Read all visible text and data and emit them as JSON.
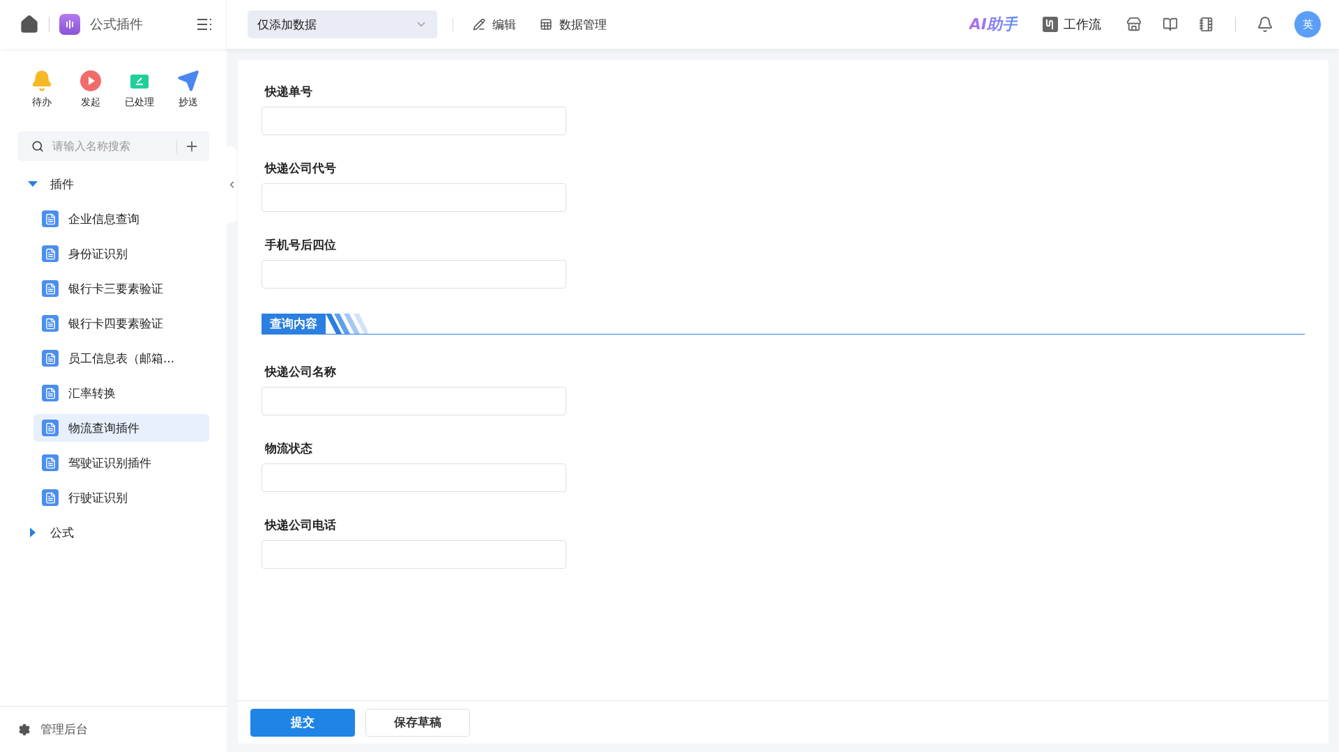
{
  "header": {
    "app_title": "公式插件",
    "mode_select": {
      "value": "仅添加数据"
    },
    "actions": [
      {
        "kind": "edit",
        "label": "编辑"
      },
      {
        "kind": "data",
        "label": "数据管理"
      }
    ],
    "ai_label": "AI助手",
    "workflow_label": "工作流",
    "avatar_text": "英"
  },
  "sidebar": {
    "quick_actions": [
      {
        "kind": "todo",
        "label": "待办"
      },
      {
        "kind": "start",
        "label": "发起"
      },
      {
        "kind": "done",
        "label": "已处理"
      },
      {
        "kind": "cc",
        "label": "抄送"
      }
    ],
    "search": {
      "placeholder": "请输入名称搜索"
    },
    "tree": [
      {
        "label": "插件",
        "expanded": true,
        "children": [
          {
            "label": "企业信息查询",
            "selected": false
          },
          {
            "label": "身份证识别",
            "selected": false
          },
          {
            "label": "银行卡三要素验证",
            "selected": false
          },
          {
            "label": "银行卡四要素验证",
            "selected": false
          },
          {
            "label": "员工信息表（邮箱...",
            "selected": false
          },
          {
            "label": "汇率转换",
            "selected": false
          },
          {
            "label": "物流查询插件",
            "selected": true
          },
          {
            "label": "驾驶证识别插件",
            "selected": false
          },
          {
            "label": "行驶证识别",
            "selected": false
          }
        ]
      },
      {
        "label": "公式",
        "expanded": false
      }
    ],
    "footer_label": "管理后台"
  },
  "form": {
    "fields": [
      {
        "label": "快递单号"
      },
      {
        "label": "快递公司代号"
      },
      {
        "label": "手机号后四位"
      }
    ],
    "section_title": "查询内容",
    "section_fields": [
      {
        "label": "快递公司名称"
      },
      {
        "label": "物流状态"
      },
      {
        "label": "快递公司电话"
      }
    ],
    "buttons": [
      {
        "kind": "primary",
        "label": "提交"
      },
      {
        "kind": "default",
        "label": "保存草稿"
      }
    ]
  }
}
